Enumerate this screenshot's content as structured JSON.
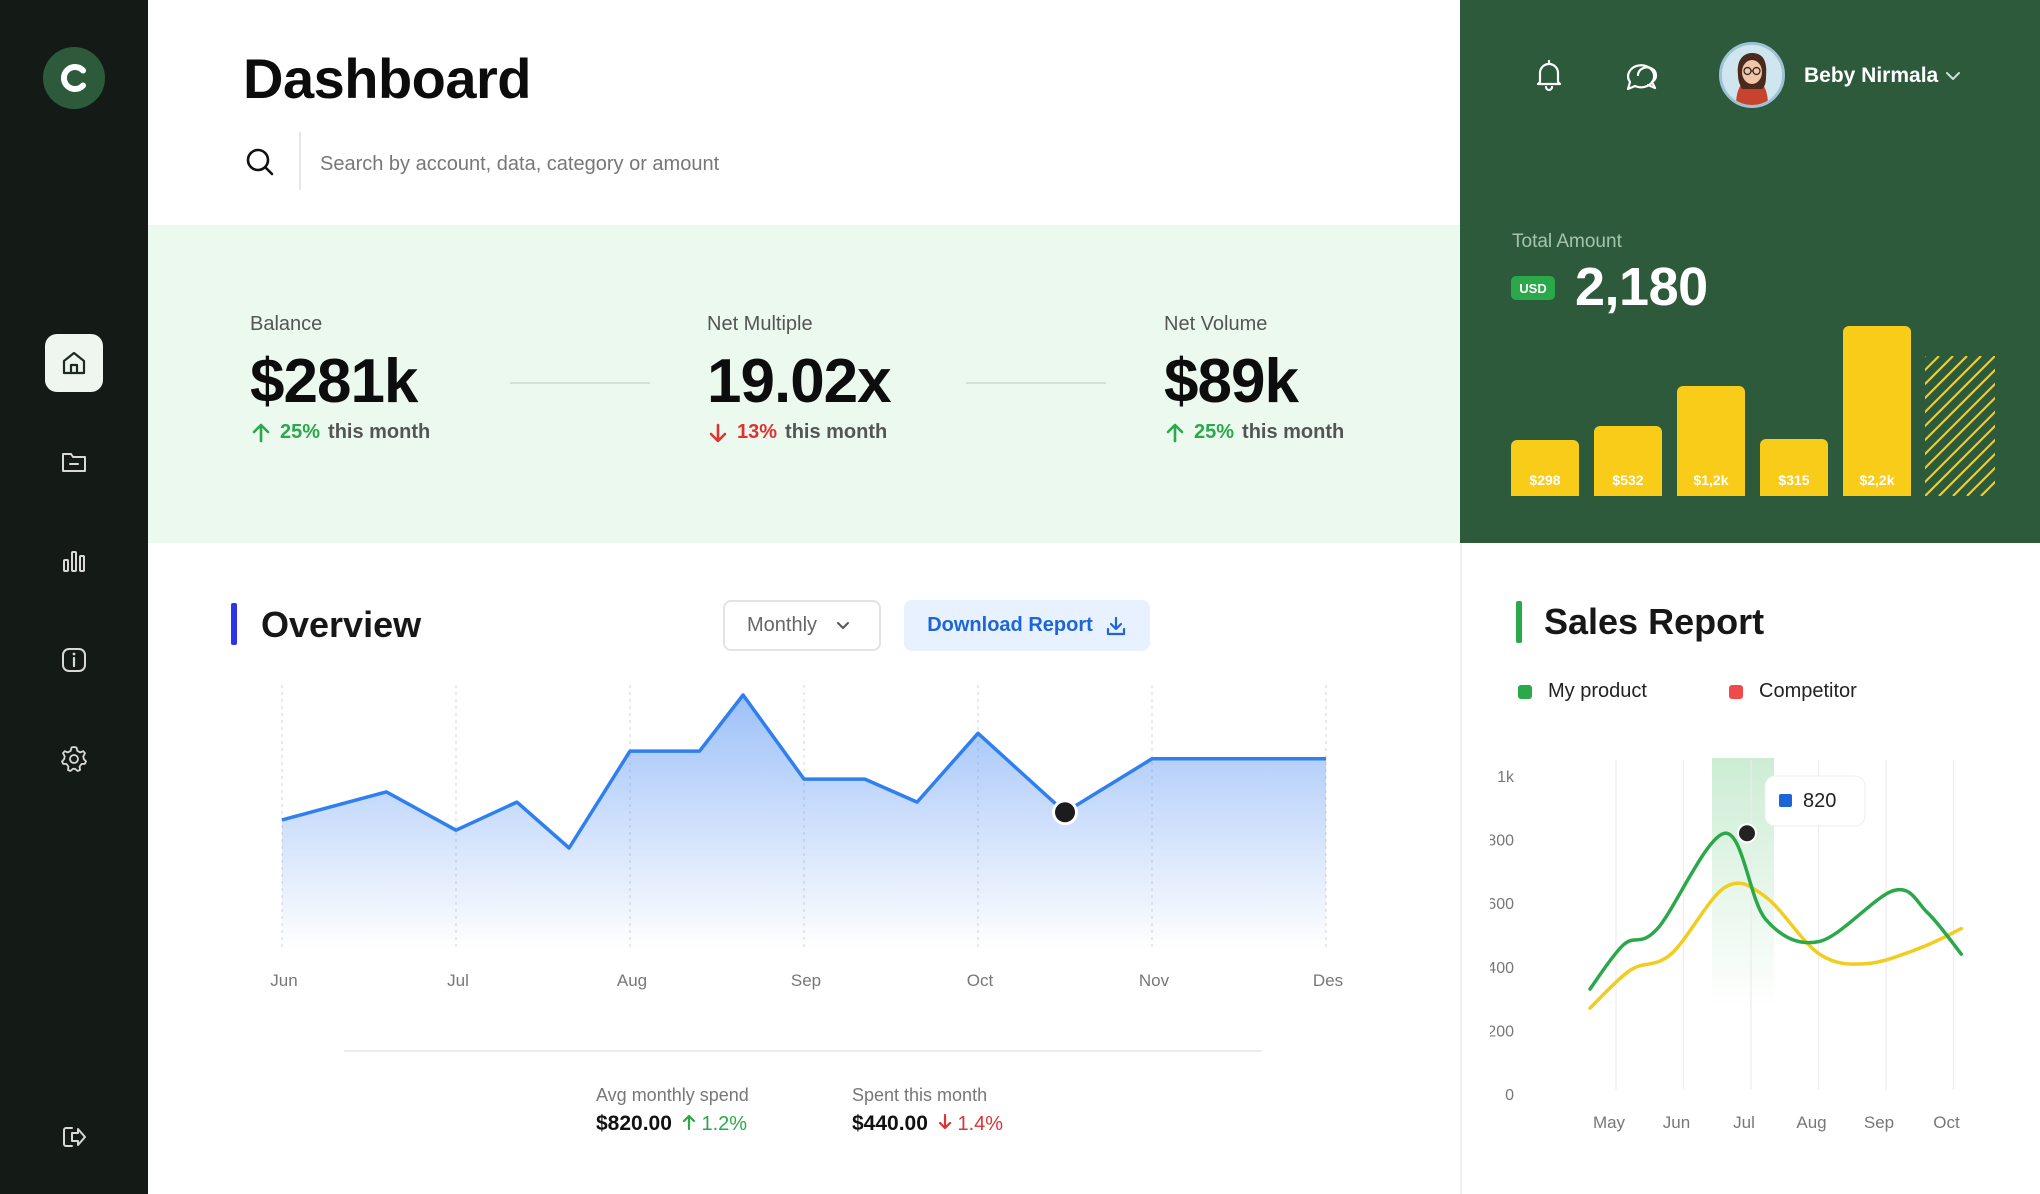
{
  "sidebar": {
    "logo_letter": "C",
    "items": [
      {
        "name": "home",
        "icon": "home-icon",
        "active": true
      },
      {
        "name": "files",
        "icon": "folder-icon",
        "active": false
      },
      {
        "name": "analytics",
        "icon": "bar-chart-icon",
        "active": false
      },
      {
        "name": "info",
        "icon": "info-icon",
        "active": false
      },
      {
        "name": "settings",
        "icon": "gear-icon",
        "active": false
      }
    ],
    "logout_icon": "logout-icon"
  },
  "header": {
    "title": "Dashboard",
    "search_placeholder": "Search by account, data, category or amount"
  },
  "stats": [
    {
      "label": "Balance",
      "value": "$281k",
      "change": "25%",
      "direction": "up",
      "suffix": "this month"
    },
    {
      "label": "Net Multiple",
      "value": "19.02x",
      "change": "13%",
      "direction": "down",
      "suffix": "this month"
    },
    {
      "label": "Net Volume",
      "value": "$89k",
      "change": "25%",
      "direction": "up",
      "suffix": "this month"
    }
  ],
  "user": {
    "name": "Beby Nirmala"
  },
  "total": {
    "label": "Total Amount",
    "currency": "USD",
    "value": "2,180",
    "bars": [
      {
        "label": "$298",
        "value": 298
      },
      {
        "label": "$532",
        "value": 532
      },
      {
        "label": "$1,2k",
        "value": 1200
      },
      {
        "label": "$315",
        "value": 315
      },
      {
        "label": "$2,2k",
        "value": 2200
      }
    ]
  },
  "overview": {
    "title": "Overview",
    "period": "Monthly",
    "download_label": "Download Report",
    "summary": [
      {
        "label": "Avg monthly spend",
        "value": "$820.00",
        "change": "1.2%",
        "direction": "up"
      },
      {
        "label": "Spent this month",
        "value": "$440.00",
        "change": "1.4%",
        "direction": "down"
      }
    ]
  },
  "sales": {
    "title": "Sales Report",
    "legend": [
      {
        "name": "My product",
        "color": "#2aa84a"
      },
      {
        "name": "Competitor",
        "color": "#f04a4a"
      }
    ],
    "tooltip_value": "820"
  },
  "chart_data": [
    {
      "type": "area",
      "title": "Overview",
      "categories": [
        "Jun",
        "Jul",
        "Aug",
        "Sep",
        "Oct",
        "Nov",
        "Des"
      ],
      "x": [
        0,
        0.6,
        1.0,
        1.35,
        1.65,
        2.0,
        2.4,
        2.65,
        3.0,
        3.35,
        3.65,
        4.0,
        4.5,
        5.0,
        5.35,
        6.0
      ],
      "values": [
        51,
        62,
        47,
        58,
        40,
        78,
        78,
        100,
        67,
        67,
        58,
        85,
        54,
        75,
        75,
        75
      ],
      "highlight_index": 12,
      "color": "#2f7ff0"
    },
    {
      "type": "line",
      "title": "Sales Report",
      "categories": [
        "May",
        "Jun",
        "Jul",
        "Aug",
        "Sep",
        "Oct"
      ],
      "ylim": [
        0,
        1000
      ],
      "yticks": [
        "0",
        "200",
        "400",
        "600",
        "800",
        "1k"
      ],
      "series": [
        {
          "name": "My product",
          "color": "#2aa84a",
          "x": [
            0,
            0.5,
            1.0,
            2.0,
            2.6,
            3.4,
            4.5,
            5.0,
            5.5
          ],
          "values": [
            330,
            470,
            520,
            820,
            550,
            480,
            640,
            570,
            440
          ]
        },
        {
          "name": "Competitor",
          "color": "#f2cc1e",
          "x": [
            0,
            0.6,
            1.2,
            2.0,
            2.6,
            3.4,
            4.1,
            4.9,
            5.5
          ],
          "values": [
            270,
            390,
            440,
            650,
            620,
            440,
            410,
            460,
            520
          ]
        }
      ],
      "tooltip": {
        "x": 2.0,
        "value": 820
      }
    }
  ]
}
